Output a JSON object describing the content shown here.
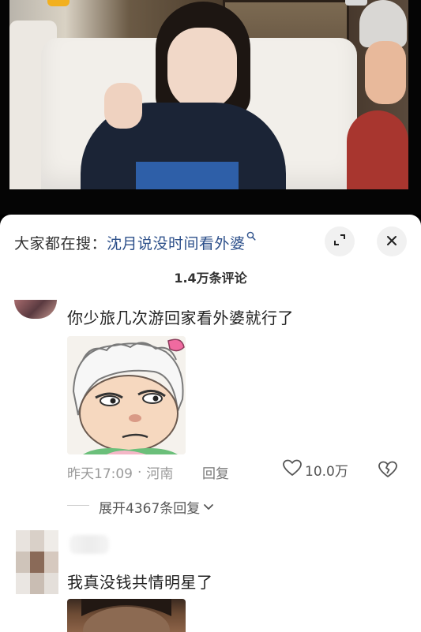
{
  "search": {
    "prefix": "大家都在搜：",
    "term": "沈月说没时间看外婆"
  },
  "comments_header": {
    "count_label": "1.4万条评论"
  },
  "comments": [
    {
      "text": "你少旅几次游回家看外婆就行了",
      "time": "昨天17:09",
      "location": "河南",
      "reply_label": "回复",
      "likes": "10.0万",
      "expand_label": "展开4367条回复"
    },
    {
      "text": "我真没钱共情明星了"
    }
  ],
  "colors": {
    "link": "#2c4f8a",
    "meta": "#9a9a9a"
  },
  "icons": {
    "expand": "expand-icon",
    "close": "close-icon",
    "like": "heart-icon",
    "dislike": "broken-heart-icon",
    "search": "search-icon"
  }
}
